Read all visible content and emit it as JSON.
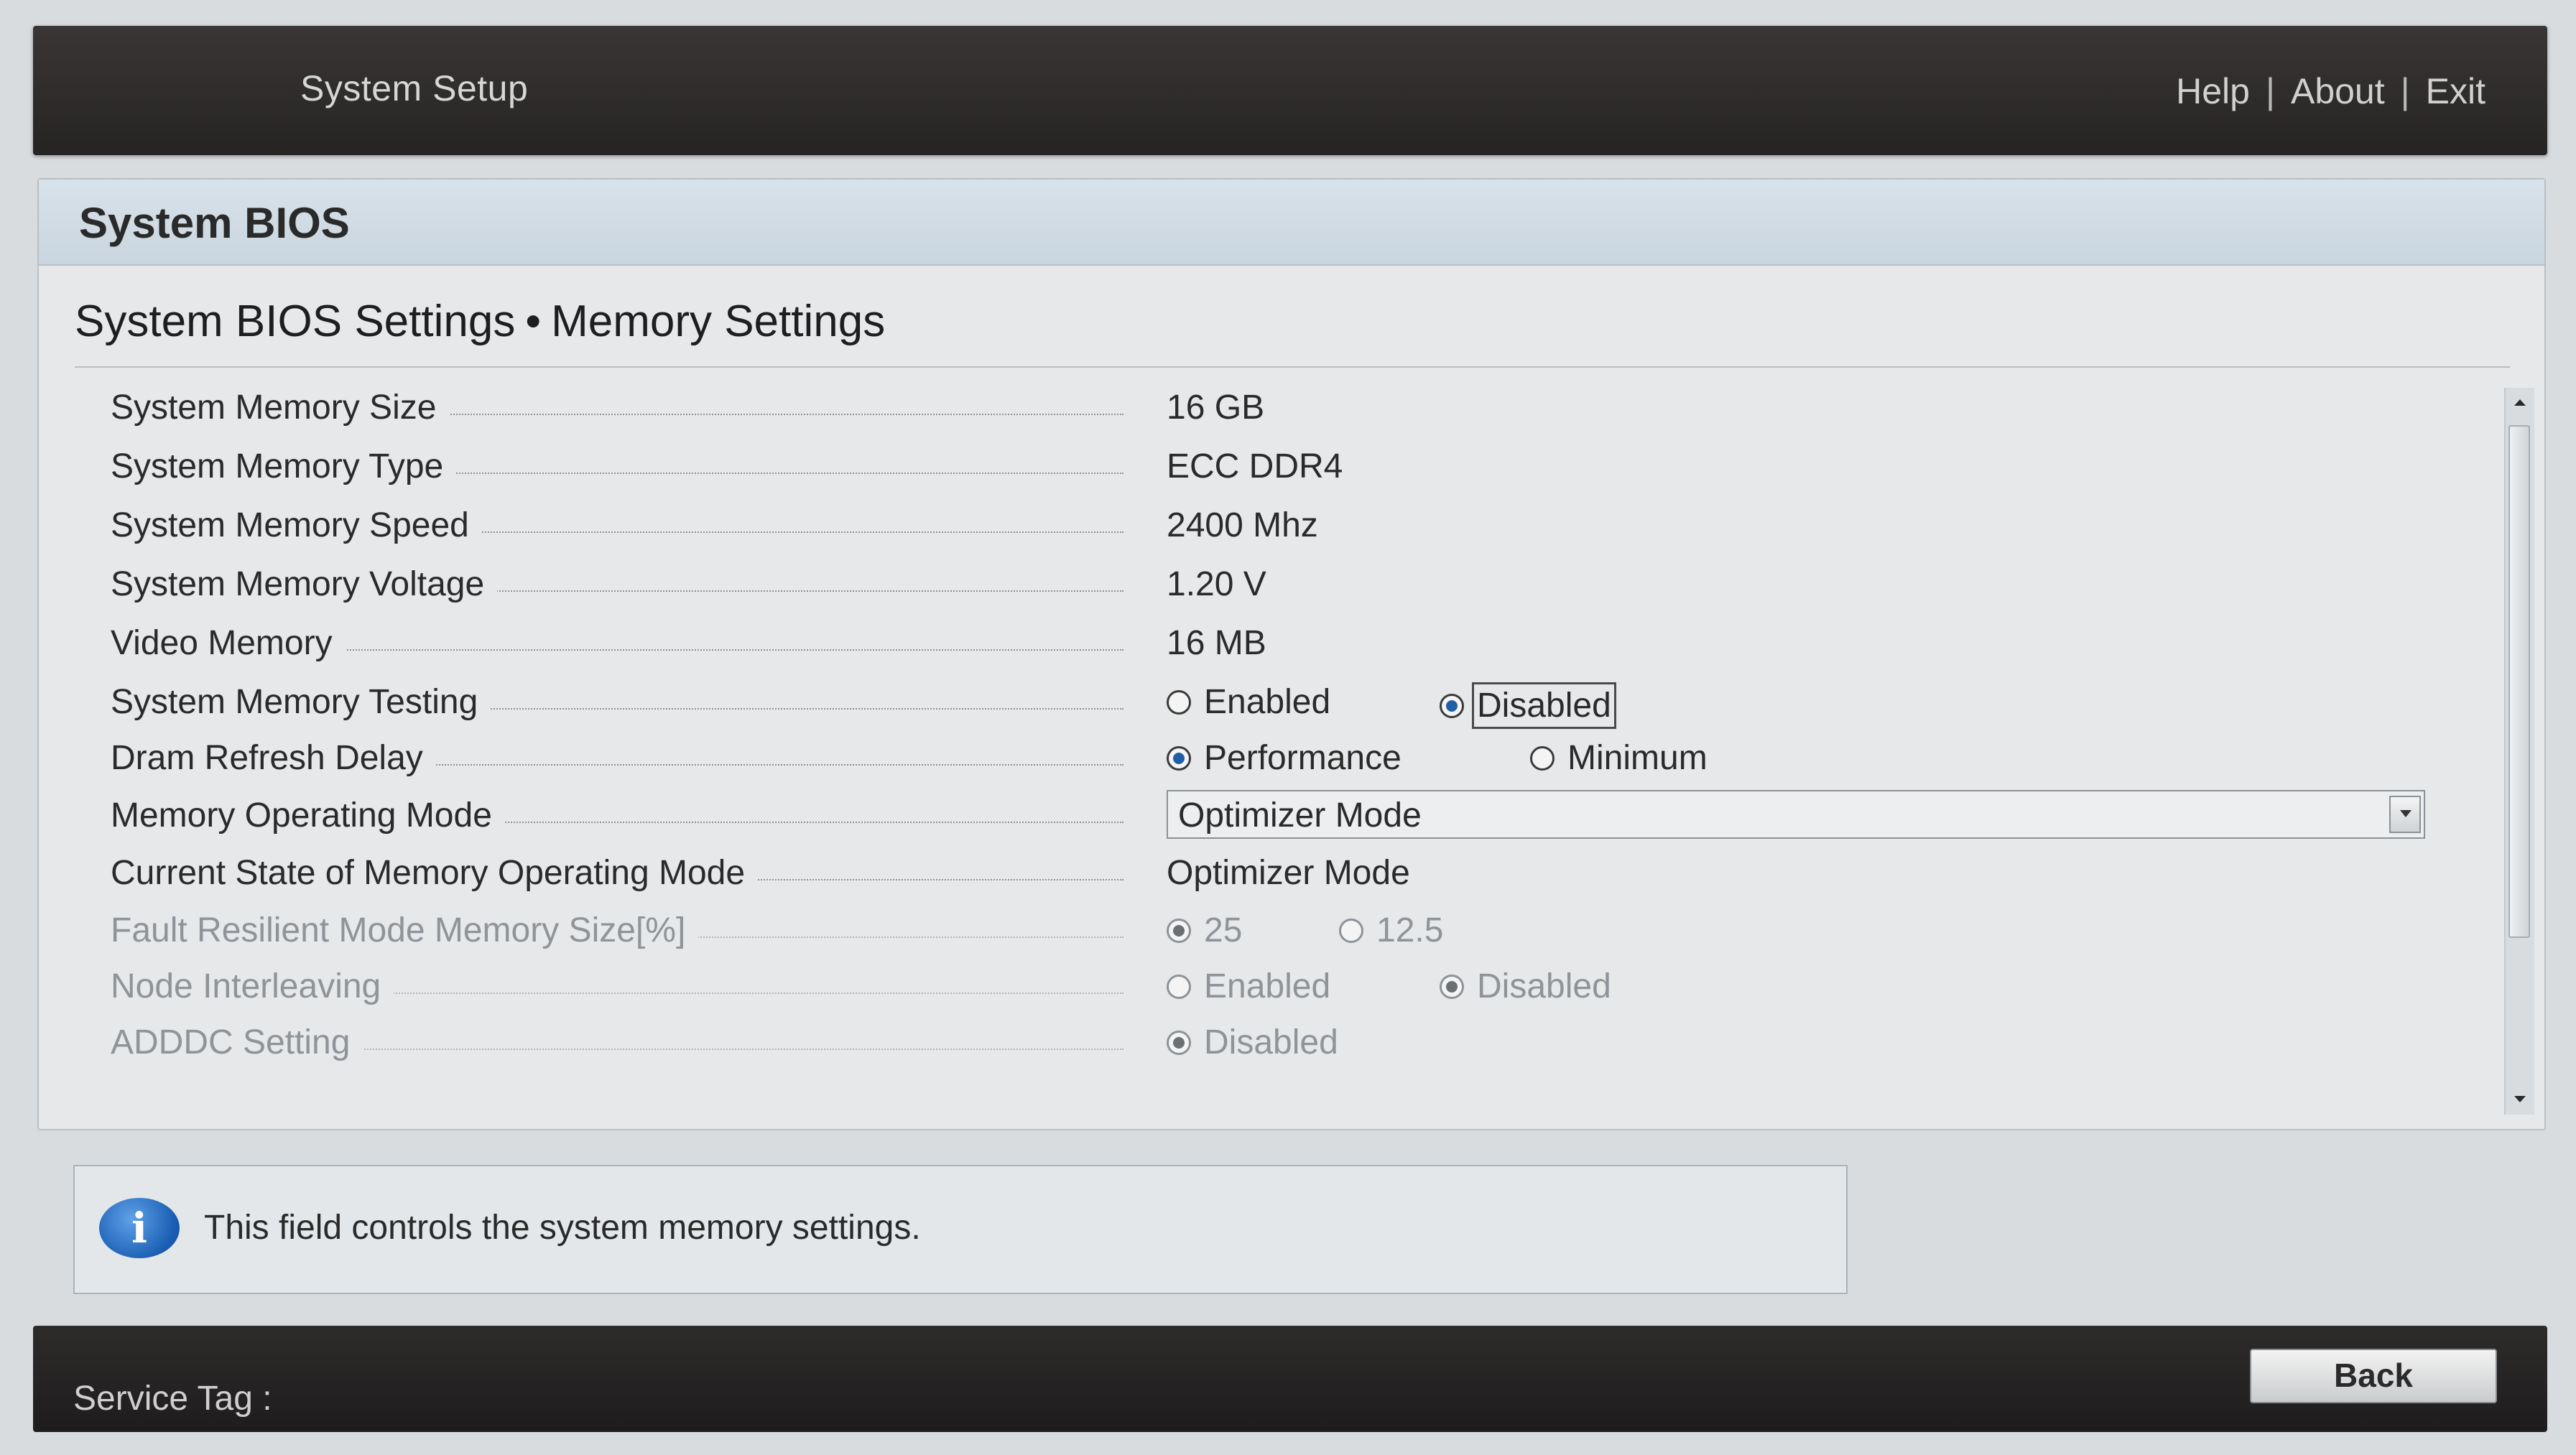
{
  "header": {
    "title": "System Setup",
    "links": [
      "Help",
      "About",
      "Exit"
    ],
    "separator": "|"
  },
  "panel": {
    "title": "System BIOS",
    "breadcrumb_parent": "System BIOS Settings",
    "breadcrumb_separator": "•",
    "breadcrumb_current": "Memory Settings"
  },
  "settings": {
    "memory_size": {
      "label": "System Memory Size",
      "value": "16 GB"
    },
    "memory_type": {
      "label": "System Memory Type",
      "value": "ECC DDR4"
    },
    "memory_speed": {
      "label": "System Memory Speed",
      "value": "2400 Mhz"
    },
    "memory_voltage": {
      "label": "System Memory Voltage",
      "value": "1.20 V"
    },
    "video_memory": {
      "label": "Video Memory",
      "value": "16 MB"
    },
    "memory_testing": {
      "label": "System Memory Testing",
      "options": [
        "Enabled",
        "Disabled"
      ],
      "selected": "Disabled",
      "enabled": true
    },
    "dram_refresh": {
      "label": "Dram Refresh Delay",
      "options": [
        "Performance",
        "Minimum"
      ],
      "selected": "Performance",
      "enabled": true
    },
    "operating_mode": {
      "label": "Memory Operating Mode",
      "selected": "Optimizer Mode"
    },
    "current_state": {
      "label": "Current State of Memory Operating Mode",
      "value": "Optimizer Mode"
    },
    "fault_resilient": {
      "label": "Fault Resilient Mode Memory Size[%]",
      "options": [
        "25",
        "12.5"
      ],
      "selected": "25",
      "enabled": false
    },
    "node_interleaving": {
      "label": "Node Interleaving",
      "options": [
        "Enabled",
        "Disabled"
      ],
      "selected": "Disabled",
      "enabled": false
    },
    "adddc": {
      "label": "ADDDC Setting",
      "options": [
        "Disabled"
      ],
      "selected": "Disabled",
      "enabled": false
    }
  },
  "info": {
    "icon": "info-icon",
    "message": "This field controls the system memory settings."
  },
  "footer": {
    "service_tag_label": "Service Tag :",
    "back_label": "Back"
  },
  "colors": {
    "header_bg": "#2e2b2b",
    "panel_header_bg": "#d2dde6",
    "radio_selected": "#1f5fa8",
    "disabled_text": "#8e9499"
  }
}
